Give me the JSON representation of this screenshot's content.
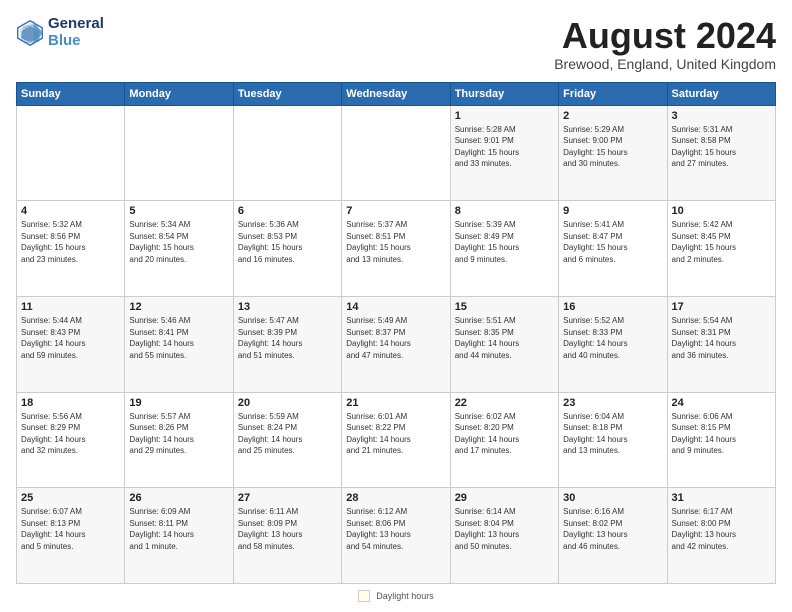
{
  "header": {
    "logo_line1": "General",
    "logo_line2": "Blue",
    "month_title": "August 2024",
    "location": "Brewood, England, United Kingdom"
  },
  "footer": {
    "daylight_label": "Daylight hours"
  },
  "weekdays": [
    "Sunday",
    "Monday",
    "Tuesday",
    "Wednesday",
    "Thursday",
    "Friday",
    "Saturday"
  ],
  "weeks": [
    [
      {
        "day": "",
        "info": ""
      },
      {
        "day": "",
        "info": ""
      },
      {
        "day": "",
        "info": ""
      },
      {
        "day": "",
        "info": ""
      },
      {
        "day": "1",
        "info": "Sunrise: 5:28 AM\nSunset: 9:01 PM\nDaylight: 15 hours\nand 33 minutes."
      },
      {
        "day": "2",
        "info": "Sunrise: 5:29 AM\nSunset: 9:00 PM\nDaylight: 15 hours\nand 30 minutes."
      },
      {
        "day": "3",
        "info": "Sunrise: 5:31 AM\nSunset: 8:58 PM\nDaylight: 15 hours\nand 27 minutes."
      }
    ],
    [
      {
        "day": "4",
        "info": "Sunrise: 5:32 AM\nSunset: 8:56 PM\nDaylight: 15 hours\nand 23 minutes."
      },
      {
        "day": "5",
        "info": "Sunrise: 5:34 AM\nSunset: 8:54 PM\nDaylight: 15 hours\nand 20 minutes."
      },
      {
        "day": "6",
        "info": "Sunrise: 5:36 AM\nSunset: 8:53 PM\nDaylight: 15 hours\nand 16 minutes."
      },
      {
        "day": "7",
        "info": "Sunrise: 5:37 AM\nSunset: 8:51 PM\nDaylight: 15 hours\nand 13 minutes."
      },
      {
        "day": "8",
        "info": "Sunrise: 5:39 AM\nSunset: 8:49 PM\nDaylight: 15 hours\nand 9 minutes."
      },
      {
        "day": "9",
        "info": "Sunrise: 5:41 AM\nSunset: 8:47 PM\nDaylight: 15 hours\nand 6 minutes."
      },
      {
        "day": "10",
        "info": "Sunrise: 5:42 AM\nSunset: 8:45 PM\nDaylight: 15 hours\nand 2 minutes."
      }
    ],
    [
      {
        "day": "11",
        "info": "Sunrise: 5:44 AM\nSunset: 8:43 PM\nDaylight: 14 hours\nand 59 minutes."
      },
      {
        "day": "12",
        "info": "Sunrise: 5:46 AM\nSunset: 8:41 PM\nDaylight: 14 hours\nand 55 minutes."
      },
      {
        "day": "13",
        "info": "Sunrise: 5:47 AM\nSunset: 8:39 PM\nDaylight: 14 hours\nand 51 minutes."
      },
      {
        "day": "14",
        "info": "Sunrise: 5:49 AM\nSunset: 8:37 PM\nDaylight: 14 hours\nand 47 minutes."
      },
      {
        "day": "15",
        "info": "Sunrise: 5:51 AM\nSunset: 8:35 PM\nDaylight: 14 hours\nand 44 minutes."
      },
      {
        "day": "16",
        "info": "Sunrise: 5:52 AM\nSunset: 8:33 PM\nDaylight: 14 hours\nand 40 minutes."
      },
      {
        "day": "17",
        "info": "Sunrise: 5:54 AM\nSunset: 8:31 PM\nDaylight: 14 hours\nand 36 minutes."
      }
    ],
    [
      {
        "day": "18",
        "info": "Sunrise: 5:56 AM\nSunset: 8:29 PM\nDaylight: 14 hours\nand 32 minutes."
      },
      {
        "day": "19",
        "info": "Sunrise: 5:57 AM\nSunset: 8:26 PM\nDaylight: 14 hours\nand 29 minutes."
      },
      {
        "day": "20",
        "info": "Sunrise: 5:59 AM\nSunset: 8:24 PM\nDaylight: 14 hours\nand 25 minutes."
      },
      {
        "day": "21",
        "info": "Sunrise: 6:01 AM\nSunset: 8:22 PM\nDaylight: 14 hours\nand 21 minutes."
      },
      {
        "day": "22",
        "info": "Sunrise: 6:02 AM\nSunset: 8:20 PM\nDaylight: 14 hours\nand 17 minutes."
      },
      {
        "day": "23",
        "info": "Sunrise: 6:04 AM\nSunset: 8:18 PM\nDaylight: 14 hours\nand 13 minutes."
      },
      {
        "day": "24",
        "info": "Sunrise: 6:06 AM\nSunset: 8:15 PM\nDaylight: 14 hours\nand 9 minutes."
      }
    ],
    [
      {
        "day": "25",
        "info": "Sunrise: 6:07 AM\nSunset: 8:13 PM\nDaylight: 14 hours\nand 5 minutes."
      },
      {
        "day": "26",
        "info": "Sunrise: 6:09 AM\nSunset: 8:11 PM\nDaylight: 14 hours\nand 1 minute."
      },
      {
        "day": "27",
        "info": "Sunrise: 6:11 AM\nSunset: 8:09 PM\nDaylight: 13 hours\nand 58 minutes."
      },
      {
        "day": "28",
        "info": "Sunrise: 6:12 AM\nSunset: 8:06 PM\nDaylight: 13 hours\nand 54 minutes."
      },
      {
        "day": "29",
        "info": "Sunrise: 6:14 AM\nSunset: 8:04 PM\nDaylight: 13 hours\nand 50 minutes."
      },
      {
        "day": "30",
        "info": "Sunrise: 6:16 AM\nSunset: 8:02 PM\nDaylight: 13 hours\nand 46 minutes."
      },
      {
        "day": "31",
        "info": "Sunrise: 6:17 AM\nSunset: 8:00 PM\nDaylight: 13 hours\nand 42 minutes."
      }
    ]
  ]
}
